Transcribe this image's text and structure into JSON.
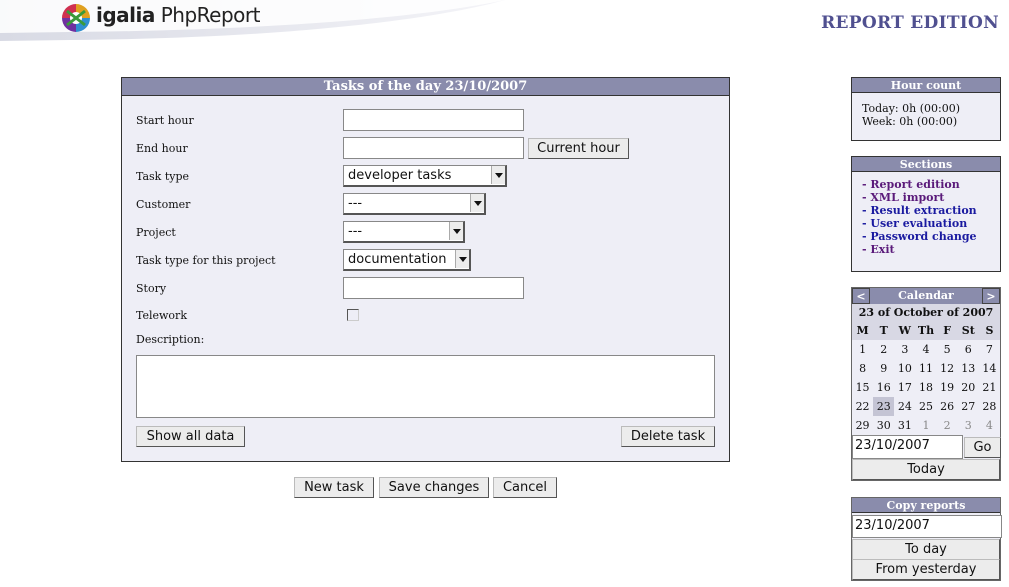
{
  "header": {
    "logo_brand": "igalia",
    "logo_product": "PhpReport",
    "page_heading": "REPORT EDITION"
  },
  "form": {
    "title": "Tasks of the day 23/10/2007",
    "start_hour_label": "Start hour",
    "start_hour_value": "",
    "end_hour_label": "End hour",
    "end_hour_value": "",
    "current_hour_button": "Current hour",
    "task_type_label": "Task type",
    "task_type_value": "developer tasks",
    "customer_label": "Customer",
    "customer_value": "---",
    "project_label": "Project",
    "project_value": "---",
    "task_type_project_label": "Task type for this project",
    "task_type_project_value": "documentation",
    "story_label": "Story",
    "story_value": "",
    "telework_label": "Telework",
    "telework_checked": false,
    "description_label": "Description:",
    "description_value": "",
    "show_all_button": "Show all data",
    "delete_task_button": "Delete task"
  },
  "actions": {
    "new_task": "New task",
    "save_changes": "Save changes",
    "cancel": "Cancel"
  },
  "hour_count": {
    "title": "Hour count",
    "today": "Today: 0h (00:00)",
    "week": "Week: 0h (00:00)"
  },
  "sections": {
    "title": "Sections",
    "items": [
      {
        "label": "- Report edition",
        "color": "#5a1a7a"
      },
      {
        "label": "- XML import",
        "color": "#5a1a7a"
      },
      {
        "label": "- Result extraction",
        "color": "#1a1aa0"
      },
      {
        "label": "- User evaluation",
        "color": "#1a1aa0"
      },
      {
        "label": "- Password change",
        "color": "#1a1aa0"
      },
      {
        "label": "- Exit",
        "color": "#5a1a7a"
      }
    ]
  },
  "calendar": {
    "title": "Calendar",
    "prev": "<",
    "next": ">",
    "current_date": "23 of October of 2007",
    "weekdays": [
      "M",
      "T",
      "W",
      "Th",
      "F",
      "St",
      "S"
    ],
    "weeks": [
      [
        "1",
        "2",
        "3",
        "4",
        "5",
        "6",
        "7"
      ],
      [
        "8",
        "9",
        "10",
        "11",
        "12",
        "13",
        "14"
      ],
      [
        "15",
        "16",
        "17",
        "18",
        "19",
        "20",
        "21"
      ],
      [
        "22",
        "23",
        "24",
        "25",
        "26",
        "27",
        "28"
      ],
      [
        "29",
        "30",
        "31",
        "1",
        "2",
        "3",
        "4"
      ]
    ],
    "today_cell": "23",
    "date_input": "23/10/2007",
    "go_button": "Go",
    "today_button": "Today"
  },
  "copy_reports": {
    "title": "Copy reports",
    "date_input": "23/10/2007",
    "to_day_button": "To day",
    "from_yesterday_button": "From yesterday"
  }
}
